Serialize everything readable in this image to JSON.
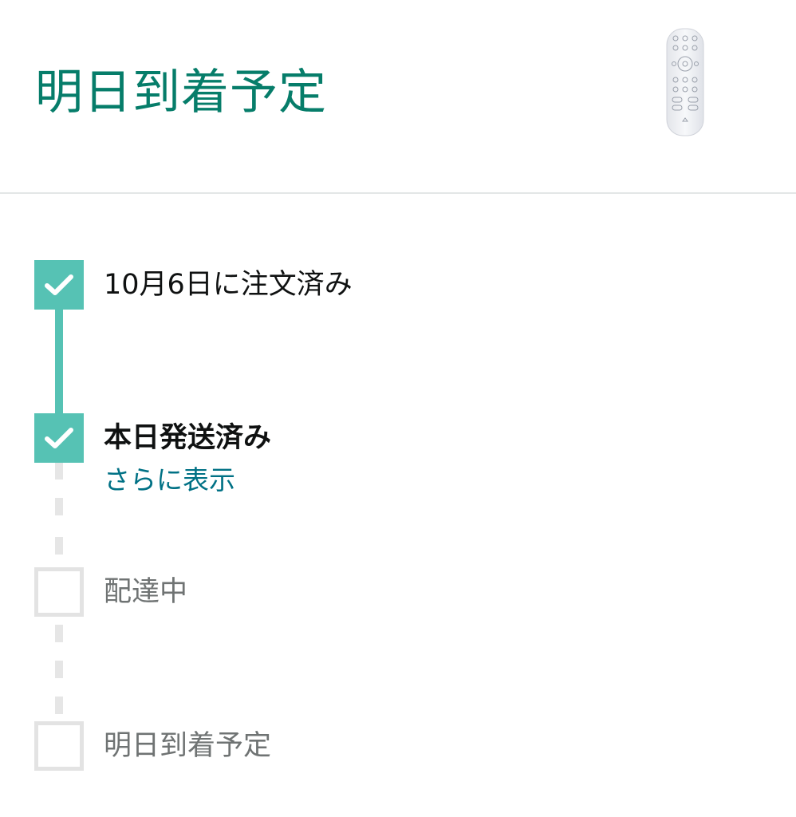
{
  "header": {
    "title": "明日到着予定",
    "product_image_icon": "media-remote-image"
  },
  "colors": {
    "accent_green": "#067d6a",
    "step_done": "#56c2b4",
    "step_pending": "#e3e3e3",
    "link": "#007185"
  },
  "timeline": {
    "steps": [
      {
        "label": "10月6日に注文済み",
        "status": "done",
        "icon": "check-icon"
      },
      {
        "label": "本日発送済み",
        "status": "done",
        "icon": "check-icon",
        "link": "さらに表示"
      },
      {
        "label": "配達中",
        "status": "pending"
      },
      {
        "label": "明日到着予定",
        "status": "pending"
      }
    ]
  }
}
